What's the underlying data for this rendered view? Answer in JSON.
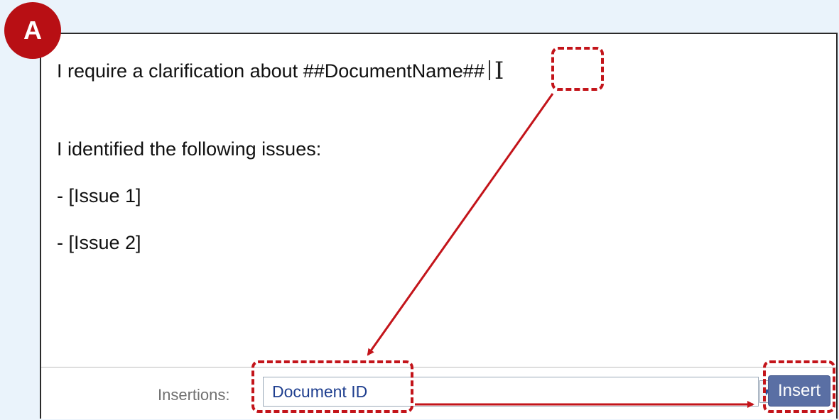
{
  "badge": {
    "label": "A"
  },
  "editor": {
    "lines": [
      "I require a clarification about ##DocumentName##",
      "I identified the following issues:",
      "- [Issue 1]",
      "- [Issue 2]"
    ]
  },
  "insertions": {
    "label": "Insertions:",
    "selected": "Document ID",
    "button_label": "Insert"
  },
  "colors": {
    "highlight": "#c3141a",
    "button": "#5a6fa4",
    "badge": "#b80f14"
  },
  "icons": {
    "cursor": "text-cursor-icon",
    "dropdown": "chevron-down-icon"
  }
}
